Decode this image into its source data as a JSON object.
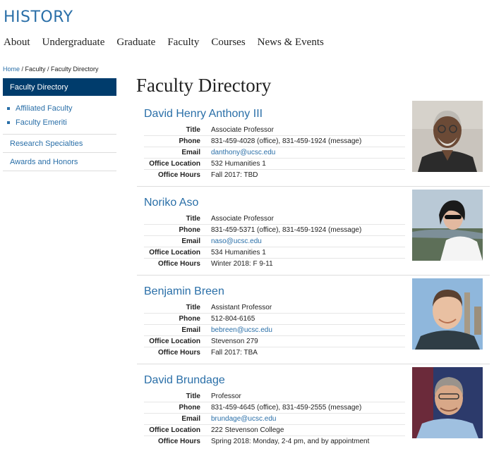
{
  "site": {
    "title": "HISTORY"
  },
  "nav": [
    "About",
    "Undergraduate",
    "Graduate",
    "Faculty",
    "Courses",
    "News & Events"
  ],
  "breadcrumb": {
    "home": "Home",
    "rest": " / Faculty / Faculty Directory"
  },
  "sidebar": {
    "active": "Faculty Directory",
    "subitems": [
      "Affiliated Faculty",
      "Faculty Emeriti"
    ],
    "links": [
      "Research Specialties",
      "Awards and Honors"
    ]
  },
  "page": {
    "title": "Faculty Directory"
  },
  "labels": {
    "title": "Title",
    "phone": "Phone",
    "email": "Email",
    "office": "Office Location",
    "hours": "Office Hours"
  },
  "faculty": [
    {
      "name": "David Henry Anthony III",
      "title": "Associate Professor",
      "phone": "831-459-4028 (office), 831-459-1924 (message)",
      "email": "danthony@ucsc.edu",
      "office": "532 Humanities 1",
      "hours": "Fall 2017: TBD"
    },
    {
      "name": "Noriko Aso",
      "title": "Associate Professor",
      "phone": "831-459-5371 (office), 831-459-1924 (message)",
      "email": "naso@ucsc.edu",
      "office": "534 Humanities 1",
      "hours": "Winter 2018: F 9-11"
    },
    {
      "name": "Benjamin Breen",
      "title": "Assistant Professor",
      "phone": "512-804-6165",
      "email": "bebreen@ucsc.edu",
      "office": "Stevenson 279",
      "hours": "Fall 2017: TBA"
    },
    {
      "name": "David Brundage",
      "title": "Professor",
      "phone": "831-459-4645 (office), 831-459-2555 (message)",
      "email": "brundage@ucsc.edu",
      "office": "222 Stevenson College",
      "hours": "Spring 2018: Monday, 2-4 pm, and by appointment"
    }
  ],
  "colors": {
    "link": "#2a6fa8",
    "active_bg": "#003c6c",
    "divider": "#dddddd"
  }
}
